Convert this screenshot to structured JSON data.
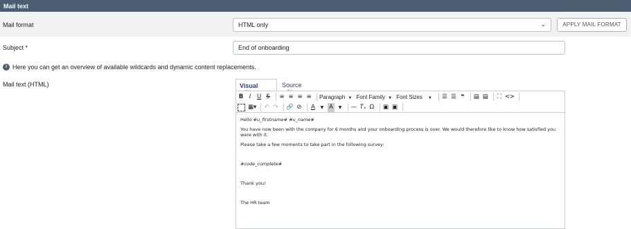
{
  "header": {
    "title": "Mail text"
  },
  "mail_format": {
    "label": "Mail format",
    "selected": "HTML only",
    "apply_button": "APPLY MAIL FORMAT"
  },
  "subject": {
    "label": "Subject *",
    "value": "End of onboarding"
  },
  "info": {
    "icon": "info-icon",
    "text": "Here you can get an overview of available wildcards and dynamic content replacements."
  },
  "mail_text": {
    "label": "Mail text (HTML)",
    "tabs": [
      "Visual editor",
      "Source editor"
    ],
    "toolbar": {
      "paragraph": "Paragraph",
      "font_family": "Font Family",
      "font_sizes": "Font Sizes"
    },
    "body": {
      "greeting_prefix": "Hello ",
      "greeting_vars": "#u_firstname# #u_name#",
      "line1": "You have now been with the company for 6 months and your onboarding process is over. We would therefore like to know how satisfied you were with it.",
      "line2": "Please take a few moments to take part in the following survey:",
      "code": "#code_complete#",
      "thanks": "Thank you!",
      "signature": "The HR team"
    }
  },
  "colors": {
    "header_bg": "#4a5d71",
    "tab_text": "#2e3f73",
    "row_bg": "#f2f2f2"
  }
}
